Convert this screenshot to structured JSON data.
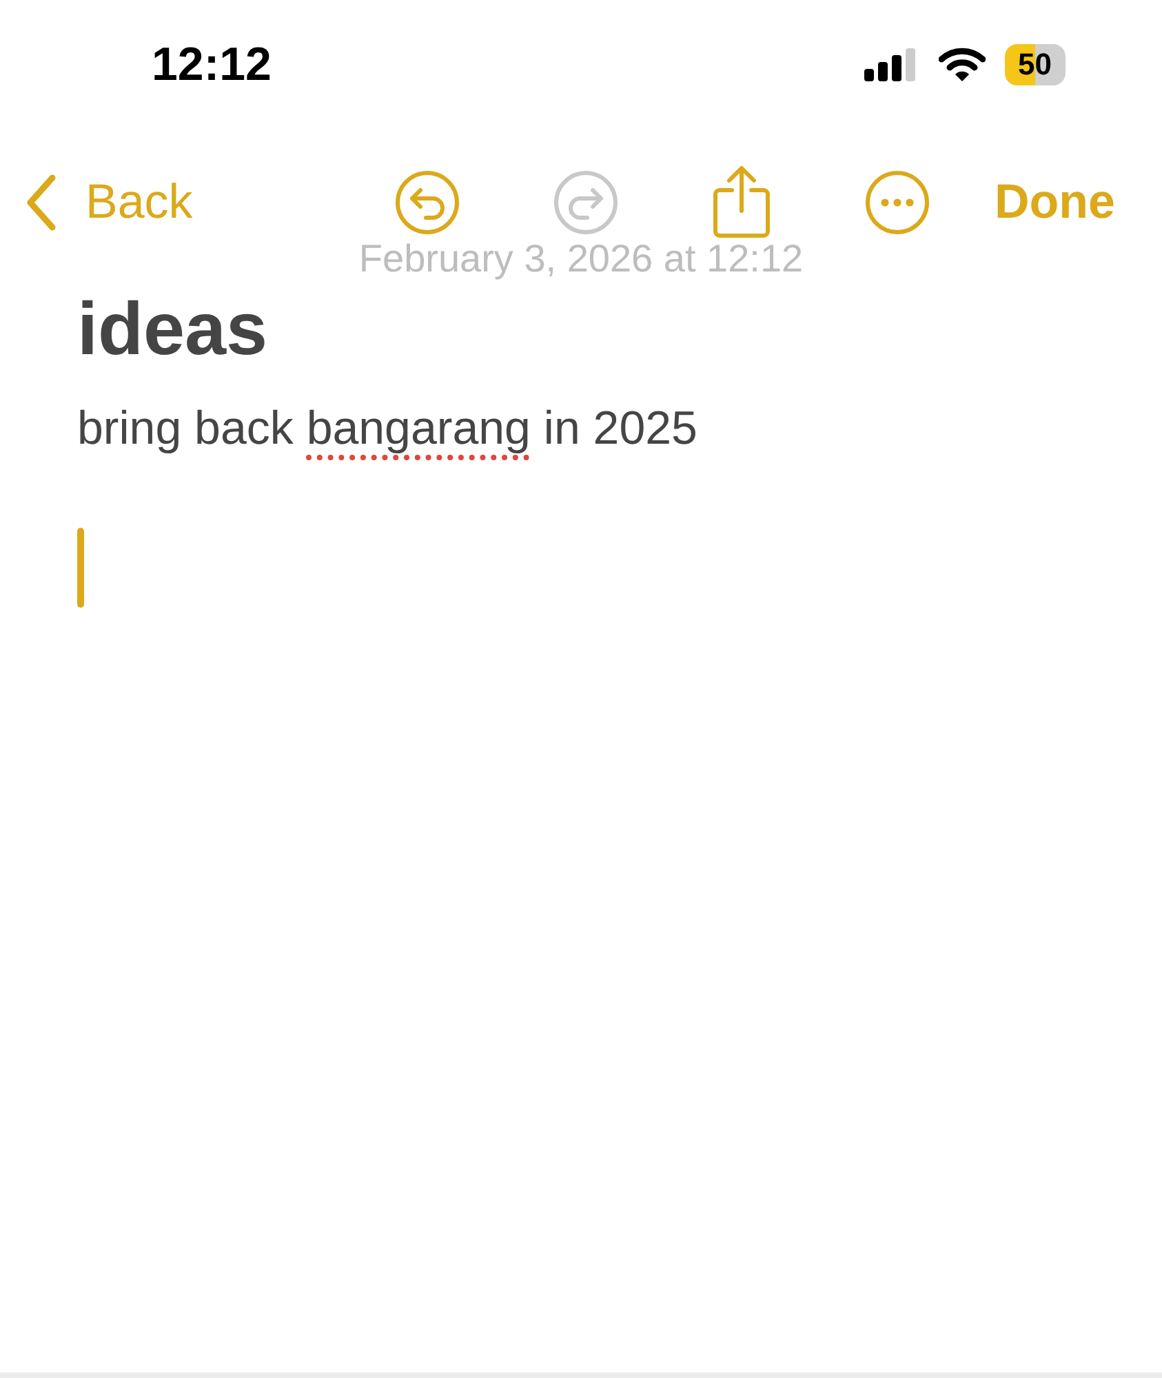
{
  "status_bar": {
    "time": "12:12",
    "battery": "50"
  },
  "toolbar": {
    "back": "Back",
    "done": "Done",
    "buttons": [
      {
        "kind": "undo",
        "disabled": false
      },
      {
        "kind": "redo",
        "disabled": true
      },
      {
        "kind": "share",
        "disabled": false
      },
      {
        "kind": "more",
        "disabled": false
      }
    ]
  },
  "note": {
    "date": "February 3, 2026 at 12:12",
    "title": "ideas",
    "body": [
      {
        "text": "bring back ",
        "misspelled": false
      },
      {
        "text": "bangarang",
        "misspelled": true
      },
      {
        "text": " in 2025",
        "misspelled": false
      }
    ]
  }
}
